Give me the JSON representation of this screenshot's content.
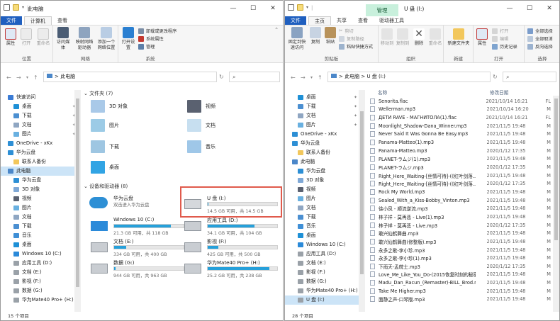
{
  "colors": {
    "accent": "#1f5fbf",
    "selection": "#cce4f7",
    "manage_tab": "#c8f0dc",
    "highlight": "#e05a4c",
    "usage_bar": "#26a0da"
  },
  "left": {
    "title": "此电脑",
    "tabs": [
      "文件",
      "计算机",
      "查看"
    ],
    "ribbon": {
      "location": {
        "label": "位置",
        "buttons": [
          "属性",
          "打开",
          "重命名"
        ]
      },
      "network": {
        "label": "网络",
        "buttons": [
          "访问媒体",
          "映射网络驱动器",
          "添加一个网络位置"
        ]
      },
      "system": {
        "label": "系统",
        "big": "打开设置",
        "small": [
          "卸载或更改程序",
          "系统属性",
          "管理"
        ]
      }
    },
    "address": {
      "path": "此电脑",
      "separator": ">",
      "icon": "computer-icon"
    },
    "nav": [
      {
        "label": "快速访问",
        "icon": "star-icon",
        "pinned": false,
        "indent": 0
      },
      {
        "label": "桌面",
        "icon": "desktop-icon",
        "pinned": true,
        "indent": 1
      },
      {
        "label": "下载",
        "icon": "download-icon",
        "pinned": true,
        "indent": 1
      },
      {
        "label": "文档",
        "icon": "document-icon",
        "pinned": true,
        "indent": 1
      },
      {
        "label": "图片",
        "icon": "picture-icon",
        "pinned": true,
        "indent": 1
      },
      {
        "label": "OneDrive - xKx",
        "icon": "cloud-icon",
        "pinned": false,
        "indent": 0
      },
      {
        "label": "华为云盘",
        "icon": "cloud-icon",
        "pinned": false,
        "indent": 0
      },
      {
        "label": "联系人备份",
        "icon": "folder-icon",
        "pinned": false,
        "indent": 1
      },
      {
        "label": "此电脑",
        "icon": "computer-icon",
        "pinned": false,
        "indent": 0,
        "selected": true
      },
      {
        "label": "华为云盘",
        "icon": "cloud-icon",
        "pinned": false,
        "indent": 1
      },
      {
        "label": "3D 对象",
        "icon": "cube-icon",
        "pinned": false,
        "indent": 1
      },
      {
        "label": "视频",
        "icon": "video-icon",
        "pinned": false,
        "indent": 1
      },
      {
        "label": "图片",
        "icon": "picture-icon",
        "pinned": false,
        "indent": 1
      },
      {
        "label": "文档",
        "icon": "document-icon",
        "pinned": false,
        "indent": 1
      },
      {
        "label": "下载",
        "icon": "download-icon",
        "pinned": false,
        "indent": 1
      },
      {
        "label": "音乐",
        "icon": "music-icon",
        "pinned": false,
        "indent": 1
      },
      {
        "label": "桌面",
        "icon": "desktop-icon",
        "pinned": false,
        "indent": 1
      },
      {
        "label": "Windows 10 (C:)",
        "icon": "windows-drive-icon",
        "pinned": false,
        "indent": 1
      },
      {
        "label": "应用工具 (D:)",
        "icon": "drive-icon",
        "pinned": false,
        "indent": 1
      },
      {
        "label": "文档 (E:)",
        "icon": "drive-icon",
        "pinned": false,
        "indent": 1
      },
      {
        "label": "影视 (F:)",
        "icon": "drive-icon",
        "pinned": false,
        "indent": 1
      },
      {
        "label": "数据 (G:)",
        "icon": "drive-icon",
        "pinned": false,
        "indent": 1
      },
      {
        "label": "华为Mate40 Pro+ (H:)",
        "icon": "drive-icon",
        "pinned": false,
        "indent": 1
      }
    ],
    "folders_header": "文件夹 (7)",
    "folders": [
      {
        "label": "3D 对象",
        "icon": "cube-icon"
      },
      {
        "label": "视频",
        "icon": "video-icon"
      },
      {
        "label": "图片",
        "icon": "picture-icon"
      },
      {
        "label": "文档",
        "icon": "document-icon"
      },
      {
        "label": "下载",
        "icon": "download-icon"
      },
      {
        "label": "音乐",
        "icon": "music-icon"
      },
      {
        "label": "桌面",
        "icon": "desktop-icon"
      }
    ],
    "drives_header": "设备和驱动器 (8)",
    "cloud": {
      "name": "华为云盘",
      "sub": "双击进入华为云盘"
    },
    "drives": [
      {
        "name": "U 盘 (I:)",
        "stats": "14.5 GB 可用，共 14.5 GB",
        "used_pct": 1,
        "icon": "usb-drive-icon",
        "highlighted": true
      },
      {
        "name": "Windows 10 (C:)",
        "stats": "21.3 GB 可用，共 118 GB",
        "used_pct": 82,
        "icon": "windows-drive-icon"
      },
      {
        "name": "应用工具 (D:)",
        "stats": "34.1 GB 可用，共 104 GB",
        "used_pct": 67,
        "icon": "drive-icon"
      },
      {
        "name": "文档 (E:)",
        "stats": "334 GB 可用，共 400 GB",
        "used_pct": 17,
        "icon": "drive-icon"
      },
      {
        "name": "影视 (F:)",
        "stats": "425 GB 可用，共 500 GB",
        "used_pct": 15,
        "icon": "drive-icon"
      },
      {
        "name": "数据 (G:)",
        "stats": "944 GB 可用，共 963 GB",
        "used_pct": 2,
        "icon": "drive-icon"
      },
      {
        "name": "华为Mate40 Pro+ (H:)",
        "stats": "25.2 GB 可用，共 238 GB",
        "used_pct": 89,
        "icon": "phone-drive-icon"
      }
    ],
    "status": "15 个项目"
  },
  "right": {
    "title": "U 盘 (I:)",
    "manage": "管理",
    "tabs": [
      "文件",
      "主页",
      "共享",
      "查看",
      "驱动器工具"
    ],
    "ribbon": {
      "clipboard": {
        "label": "剪贴板",
        "buttons": [
          "固定到快速访问",
          "复制",
          "粘贴"
        ],
        "small": [
          "剪切",
          "复制路径",
          "粘贴快捷方式"
        ]
      },
      "organize": {
        "label": "组织",
        "buttons": [
          "移动到",
          "复制到",
          "删除",
          "重命名"
        ]
      },
      "new": {
        "label": "新建",
        "buttons": [
          "新建文件夹"
        ]
      },
      "open": {
        "label": "打开",
        "buttons": [
          "属性"
        ],
        "small": [
          "打开",
          "编辑",
          "历史记录"
        ]
      },
      "select": {
        "label": "选择",
        "small": [
          "全部选择",
          "全部取消",
          "反向选择"
        ]
      }
    },
    "address": {
      "path": "U 盘 (I:)",
      "separator": ">",
      "icon": "computer-icon",
      "root": "此电脑"
    },
    "nav": [
      {
        "label": "桌面",
        "icon": "desktop-icon",
        "pinned": true,
        "indent": 1
      },
      {
        "label": "下载",
        "icon": "download-icon",
        "pinned": true,
        "indent": 1
      },
      {
        "label": "文档",
        "icon": "document-icon",
        "pinned": true,
        "indent": 1
      },
      {
        "label": "图片",
        "icon": "picture-icon",
        "pinned": true,
        "indent": 1
      },
      {
        "label": "OneDrive - xKx",
        "icon": "cloud-icon",
        "pinned": false,
        "indent": 0
      },
      {
        "label": "华为云盘",
        "icon": "cloud-icon",
        "pinned": false,
        "indent": 0
      },
      {
        "label": "联系人备份",
        "icon": "folder-icon",
        "pinned": false,
        "indent": 1
      },
      {
        "label": "此电脑",
        "icon": "computer-icon",
        "pinned": false,
        "indent": 0
      },
      {
        "label": "华为云盘",
        "icon": "cloud-icon",
        "pinned": false,
        "indent": 1
      },
      {
        "label": "3D 对象",
        "icon": "cube-icon",
        "pinned": false,
        "indent": 1
      },
      {
        "label": "视频",
        "icon": "video-icon",
        "pinned": false,
        "indent": 1
      },
      {
        "label": "图片",
        "icon": "picture-icon",
        "pinned": false,
        "indent": 1
      },
      {
        "label": "文档",
        "icon": "document-icon",
        "pinned": false,
        "indent": 1
      },
      {
        "label": "下载",
        "icon": "download-icon",
        "pinned": false,
        "indent": 1
      },
      {
        "label": "音乐",
        "icon": "music-icon",
        "pinned": false,
        "indent": 1
      },
      {
        "label": "桌面",
        "icon": "desktop-icon",
        "pinned": false,
        "indent": 1
      },
      {
        "label": "Windows 10 (C:)",
        "icon": "windows-drive-icon",
        "pinned": false,
        "indent": 1
      },
      {
        "label": "应用工具 (D:)",
        "icon": "drive-icon",
        "pinned": false,
        "indent": 1
      },
      {
        "label": "文档 (E:)",
        "icon": "drive-icon",
        "pinned": false,
        "indent": 1
      },
      {
        "label": "影视 (F:)",
        "icon": "drive-icon",
        "pinned": false,
        "indent": 1
      },
      {
        "label": "数据 (G:)",
        "icon": "drive-icon",
        "pinned": false,
        "indent": 1
      },
      {
        "label": "华为Mate40 Pro+ (H:)",
        "icon": "drive-icon",
        "pinned": false,
        "indent": 1
      },
      {
        "label": "U 盘 (I:)",
        "icon": "usb-drive-icon",
        "pinned": false,
        "indent": 1,
        "selected": true
      }
    ],
    "columns": [
      "名称",
      "修改日期",
      "类型"
    ],
    "files": [
      {
        "name": "Senorita.flac",
        "date": "2021/10/14 16:21",
        "type": "FL"
      },
      {
        "name": "Wellerman.mp3",
        "date": "2021/10/14 16:20",
        "type": "M"
      },
      {
        "name": "ДЕТИ RAVE - МАГНИТОЛА(1).flac",
        "date": "2021/10/14 16:21",
        "type": "FL"
      },
      {
        "name": "Moonlight_Shadow-Dana_Winner.mp3",
        "date": "2021/11/5 19:48",
        "type": "M"
      },
      {
        "name": "Never Said It Was Gonna Be Easy.mp3",
        "date": "2021/11/5 19:48",
        "type": "M"
      },
      {
        "name": "Panama-Matteo(1).mp3",
        "date": "2021/11/5 19:48",
        "type": "M"
      },
      {
        "name": "Panama-Matteo.mp3",
        "date": "2020/1/12 17:35",
        "type": "M"
      },
      {
        "name": "PLANET-ラムジ(1).mp3",
        "date": "2021/11/5 19:48",
        "type": "M"
      },
      {
        "name": "PLANET-ラムジ.mp3",
        "date": "2020/1/12 17:35",
        "type": "M"
      },
      {
        "name": "Right_Here_Waiting-[丝情可待]-(《红叶剑落...",
        "date": "2021/11/5 19:48",
        "type": "M"
      },
      {
        "name": "Right_Here_Waiting-[丝情可待]-(《红叶剑落...",
        "date": "2020/1/12 17:35",
        "type": "M"
      },
      {
        "name": "Rock My World.mp3",
        "date": "2021/11/5 19:48",
        "type": "M"
      },
      {
        "name": "Sealed_With_a_Kiss-Bobby_Vinton.mp3",
        "date": "2021/11/5 19:48",
        "type": "M"
      },
      {
        "name": "徐小凤 - 顺流逆流.mp3",
        "date": "2021/11/5 19:48",
        "type": "M"
      },
      {
        "name": "林子祥 - 莫再悲 - Live(1).mp3",
        "date": "2021/11/5 19:48",
        "type": "M"
      },
      {
        "name": "林子祥 - 莫再悲 - Live.mp3",
        "date": "2020/1/12 17:35",
        "type": "M"
      },
      {
        "name": "敢兴仙鹤舞曲.mp3",
        "date": "2021/11/5 19:48",
        "type": "M"
      },
      {
        "name": "敢兴仙鹤舞曲(修整版).mp3",
        "date": "2021/11/5 19:48",
        "type": "M"
      },
      {
        "name": "永多之歌-李小珍.mp3",
        "date": "2021/11/5 19:48",
        "type": "M"
      },
      {
        "name": "永多之歌-李小珍(1).mp3",
        "date": "2021/11/5 19:48",
        "type": "M"
      },
      {
        "name": "下雨天-孟皖士.mp3",
        "date": "2020/1/12 17:35",
        "type": "M"
      },
      {
        "name": "Love_Me_Like_You_Do-(2015恢复时刻的秘密...",
        "date": "2021/11/5 19:48",
        "type": "M"
      },
      {
        "name": "Madu_Dan_Racun_(Remaster)-BILL_Brod.m...",
        "date": "2021/11/5 19:48",
        "type": "M"
      },
      {
        "name": "Take Me Higher.mp3",
        "date": "2021/11/5 19:48",
        "type": "M"
      },
      {
        "name": "面静之声-口琴版.mp3",
        "date": "2021/11/5 19:48",
        "type": "M"
      }
    ],
    "status": "28 个项目"
  }
}
